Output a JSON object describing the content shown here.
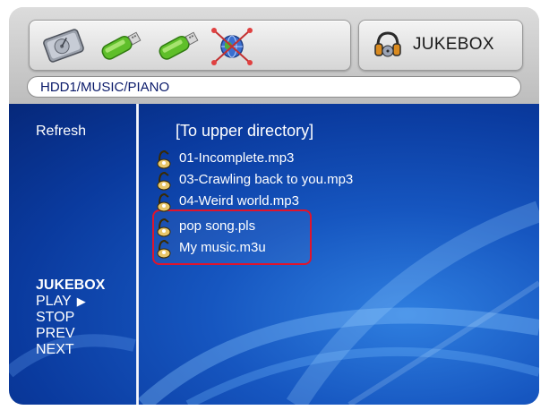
{
  "toolbar": {
    "devices": [
      {
        "icon": "hard-disk-icon"
      },
      {
        "icon": "usb-drive-icon"
      },
      {
        "icon": "usb-drive-icon"
      },
      {
        "icon": "network-globe-icon"
      }
    ],
    "mode_label": "JUKEBOX",
    "mode_icon": "headphones-icon"
  },
  "path": "HDD1/MUSIC/PIANO",
  "left_menu": {
    "refresh": "Refresh",
    "section_title": "JUKEBOX",
    "items": [
      {
        "label": "PLAY"
      },
      {
        "label": "STOP"
      },
      {
        "label": "PREV"
      },
      {
        "label": "NEXT"
      }
    ],
    "play_glyph": "▶"
  },
  "files": {
    "upper": "[To upper directory]",
    "items": [
      {
        "name": "01-Incomplete.mp3",
        "icon": "music-note-icon"
      },
      {
        "name": "03-Crawling back to you.mp3",
        "icon": "music-note-icon"
      },
      {
        "name": "04-Weird world.mp3",
        "icon": "music-note-icon"
      },
      {
        "name": "pop song.pls",
        "icon": "playlist-icon"
      },
      {
        "name": "My music.m3u",
        "icon": "playlist-icon"
      }
    ]
  },
  "colors": {
    "highlight": "#e0142c",
    "content_blue": "#1656c0",
    "path_text": "#0a1a6a"
  }
}
